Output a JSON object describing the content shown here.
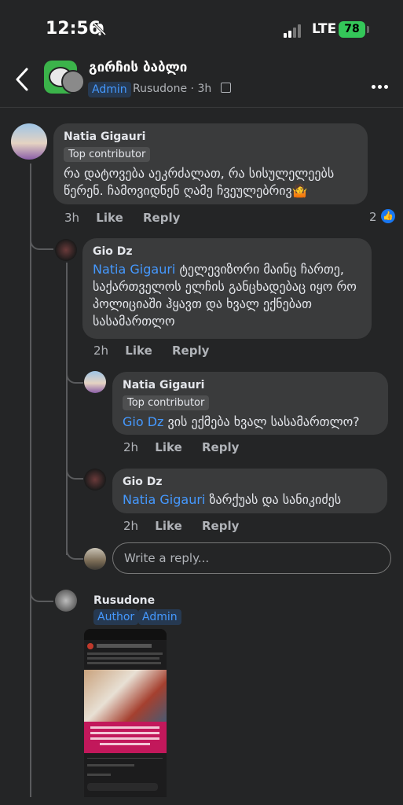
{
  "status": {
    "time": "12:56",
    "network": "LTE",
    "battery": "78"
  },
  "header": {
    "group_name": "გირჩის ბაბლი",
    "admin_badge": "Admin",
    "poster": "Rusudone",
    "time": "3h"
  },
  "comments": [
    {
      "name": "Natia Gigauri",
      "badge": "Top contributor",
      "text": "რა დატოვება აეკრძალათ, რა სისულელეებს წერენ. ჩამოვიდნენ ღამე ჩვეულებრივ🤷",
      "time": "3h",
      "like": "Like",
      "reply": "Reply",
      "reactions": "2"
    },
    {
      "name": "Gio Dz",
      "mention": "Natia Gigauri",
      "text": " ტელევიზორი მაინც ჩართე, საქართველოს ელჩის განცხადებაც იყო რო პოლიციაში ჰყავთ და ხვალ ექნებათ სასამართლო",
      "time": "2h",
      "like": "Like",
      "reply": "Reply"
    },
    {
      "name": "Natia Gigauri",
      "badge": "Top contributor",
      "mention": "Gio Dz",
      "text": " ვის ექმება ხვალ სასამართლო?",
      "time": "2h",
      "like": "Like",
      "reply": "Reply"
    },
    {
      "name": "Gio Dz",
      "mention": "Natia Gigauri",
      "text": " ზარქუას და სანიკიძეს",
      "time": "2h",
      "like": "Like",
      "reply": "Reply"
    }
  ],
  "reply_box": {
    "placeholder": "Write a reply..."
  },
  "author_comment": {
    "name": "Rusudone",
    "badge_author": "Author",
    "badge_admin": "Admin"
  },
  "colors": {
    "background": "#242526",
    "bubble": "#3a3b3c",
    "mention": "#4599ff",
    "badge_bg": "#263951"
  }
}
